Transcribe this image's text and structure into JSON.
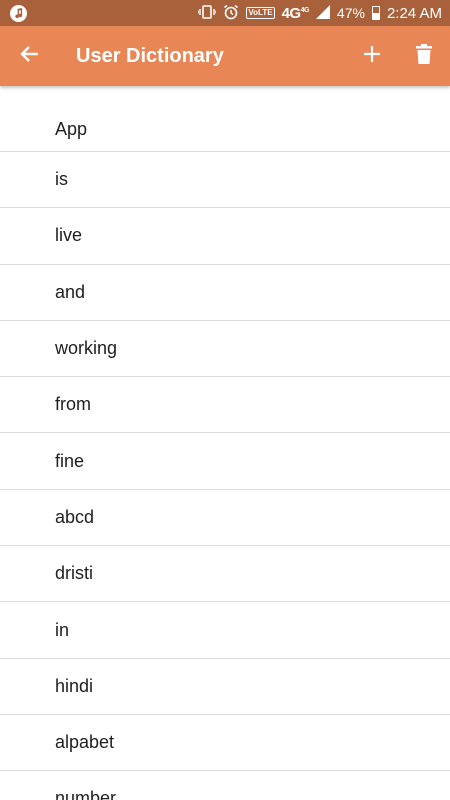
{
  "status_bar": {
    "music_icon": "music-note-icon",
    "volte_label": "VoLTE",
    "network_label": "4G",
    "network_sup": "4G",
    "battery_percent": "47%",
    "battery_level": 0.47,
    "time": "2:24 AM"
  },
  "app_bar": {
    "title": "User Dictionary",
    "back_icon": "arrow-back-icon",
    "add_icon": "plus-icon",
    "delete_icon": "trash-icon",
    "background_color": "#e98656"
  },
  "words": [
    "App",
    "is",
    "live",
    "and",
    "working",
    "from",
    "fine",
    "abcd",
    "dristi",
    "in",
    "hindi",
    "alpabet",
    "number"
  ]
}
